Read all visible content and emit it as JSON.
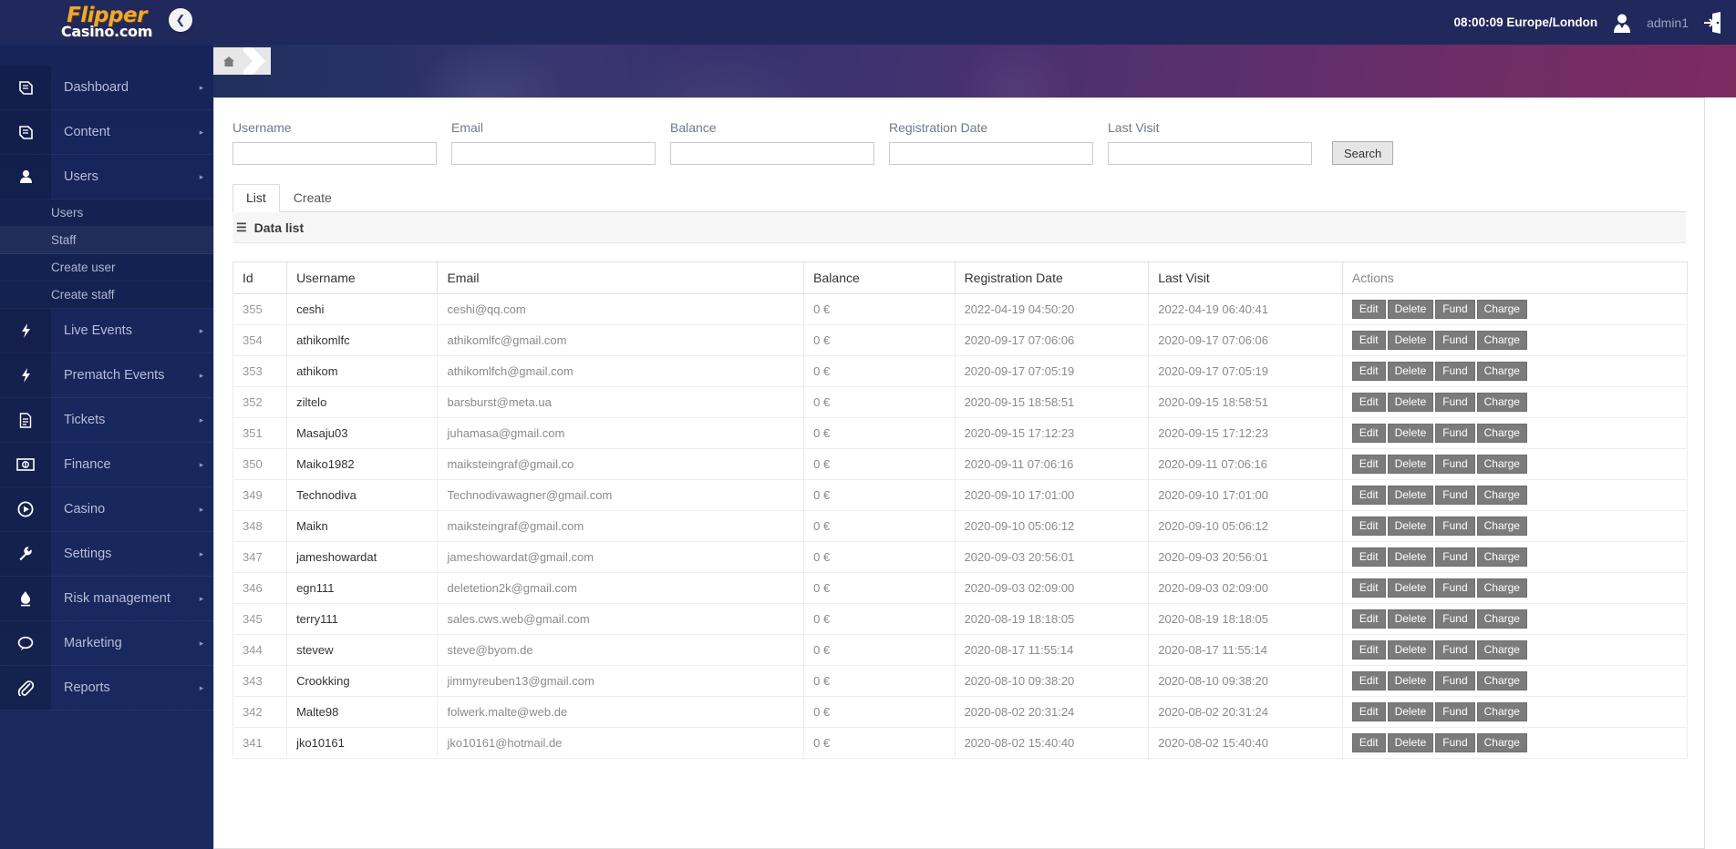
{
  "brand": {
    "name_top": "Flipper",
    "name_bottom": "Casino.com",
    "accent": "#f0a830",
    "sidebar_bg": "#17265a",
    "topbar_bg": "#21285c"
  },
  "topbar": {
    "clock": "08:00:09 Europe/London",
    "username": "admin1",
    "avatar_icon": "user-avatar-icon",
    "logout_icon": "logout-icon"
  },
  "sidebar": {
    "collapse_icon": "chevron-left-icon",
    "items": [
      {
        "label": "Dashboard",
        "icon": "book-icon",
        "arrow": "▸"
      },
      {
        "label": "Content",
        "icon": "book-icon",
        "arrow": "▸"
      },
      {
        "label": "Users",
        "icon": "user-icon",
        "arrow": "▸"
      },
      {
        "label": "Live Events",
        "icon": "bolt-icon",
        "arrow": "▸"
      },
      {
        "label": "Prematch Events",
        "icon": "bolt-icon",
        "arrow": "▸"
      },
      {
        "label": "Tickets",
        "icon": "document-icon",
        "arrow": "▸"
      },
      {
        "label": "Finance",
        "icon": "money-icon",
        "arrow": "▸"
      },
      {
        "label": "Casino",
        "icon": "play-circle-icon",
        "arrow": "▸"
      },
      {
        "label": "Settings",
        "icon": "wrench-icon",
        "arrow": "▸"
      },
      {
        "label": "Risk management",
        "icon": "flame-icon",
        "arrow": "▸"
      },
      {
        "label": "Marketing",
        "icon": "chat-icon",
        "arrow": "▸"
      },
      {
        "label": "Reports",
        "icon": "paperclip-icon",
        "arrow": "▸"
      }
    ],
    "users_submenu": [
      {
        "label": "Users",
        "active": false
      },
      {
        "label": "Staff",
        "active": true
      },
      {
        "label": "Create user",
        "active": false
      },
      {
        "label": "Create staff",
        "active": false
      }
    ]
  },
  "breadcrumb": {
    "home_icon": "home-icon",
    "chevron_icon": "chevron-right-icon"
  },
  "filters": {
    "fields": [
      {
        "label": "Username",
        "value": "",
        "placeholder": ""
      },
      {
        "label": "Email",
        "value": "",
        "placeholder": ""
      },
      {
        "label": "Balance",
        "value": "",
        "placeholder": ""
      },
      {
        "label": "Registration Date",
        "value": "",
        "placeholder": ""
      },
      {
        "label": "Last Visit",
        "value": "",
        "placeholder": ""
      }
    ],
    "search_label": "Search"
  },
  "tabs": [
    {
      "label": "List",
      "active": true
    },
    {
      "label": "Create",
      "active": false
    }
  ],
  "panel": {
    "icon": "hamburger-icon",
    "title": "Data list"
  },
  "table": {
    "columns": [
      "Id",
      "Username",
      "Email",
      "Balance",
      "Registration Date",
      "Last Visit",
      "Actions"
    ],
    "action_labels": [
      "Edit",
      "Delete",
      "Fund",
      "Charge"
    ],
    "rows": [
      {
        "id": "355",
        "username": "ceshi",
        "email": "ceshi@qq.com",
        "balance": "0 €",
        "registration": "2022-04-19 04:50:20",
        "last_visit": "2022-04-19 06:40:41"
      },
      {
        "id": "354",
        "username": "athikomlfc",
        "email": "athikomlfc@gmail.com",
        "balance": "0 €",
        "registration": "2020-09-17 07:06:06",
        "last_visit": "2020-09-17 07:06:06"
      },
      {
        "id": "353",
        "username": "athikom",
        "email": "athikomlfch@gmail.com",
        "balance": "0 €",
        "registration": "2020-09-17 07:05:19",
        "last_visit": "2020-09-17 07:05:19"
      },
      {
        "id": "352",
        "username": "ziltelo",
        "email": "barsburst@meta.ua",
        "balance": "0 €",
        "registration": "2020-09-15 18:58:51",
        "last_visit": "2020-09-15 18:58:51"
      },
      {
        "id": "351",
        "username": "Masaju03",
        "email": "juhamasa@gmail.com",
        "balance": "0 €",
        "registration": "2020-09-15 17:12:23",
        "last_visit": "2020-09-15 17:12:23"
      },
      {
        "id": "350",
        "username": "Maiko1982",
        "email": "maiksteingraf@gmail.co",
        "balance": "0 €",
        "registration": "2020-09-11 07:06:16",
        "last_visit": "2020-09-11 07:06:16"
      },
      {
        "id": "349",
        "username": "Technodiva",
        "email": "Technodivawagner@gmail.com",
        "balance": "0 €",
        "registration": "2020-09-10 17:01:00",
        "last_visit": "2020-09-10 17:01:00"
      },
      {
        "id": "348",
        "username": "Maikn",
        "email": "maiksteingraf@gmail.com",
        "balance": "0 €",
        "registration": "2020-09-10 05:06:12",
        "last_visit": "2020-09-10 05:06:12"
      },
      {
        "id": "347",
        "username": "jameshowardat",
        "email": "jameshowardat@gmail.com",
        "balance": "0 €",
        "registration": "2020-09-03 20:56:01",
        "last_visit": "2020-09-03 20:56:01"
      },
      {
        "id": "346",
        "username": "egn111",
        "email": "deletetion2k@gmail.com",
        "balance": "0 €",
        "registration": "2020-09-03 02:09:00",
        "last_visit": "2020-09-03 02:09:00"
      },
      {
        "id": "345",
        "username": "terry111",
        "email": "sales.cws.web@gmail.com",
        "balance": "0 €",
        "registration": "2020-08-19 18:18:05",
        "last_visit": "2020-08-19 18:18:05"
      },
      {
        "id": "344",
        "username": "stevew",
        "email": "steve@byom.de",
        "balance": "0 €",
        "registration": "2020-08-17 11:55:14",
        "last_visit": "2020-08-17 11:55:14"
      },
      {
        "id": "343",
        "username": "Crookking",
        "email": "jimmyreuben13@gmail.com",
        "balance": "0 €",
        "registration": "2020-08-10 09:38:20",
        "last_visit": "2020-08-10 09:38:20"
      },
      {
        "id": "342",
        "username": "Malte98",
        "email": "folwerk.malte@web.de",
        "balance": "0 €",
        "registration": "2020-08-02 20:31:24",
        "last_visit": "2020-08-02 20:31:24"
      },
      {
        "id": "341",
        "username": "jko10161",
        "email": "jko10161@hotmail.de",
        "balance": "0 €",
        "registration": "2020-08-02 15:40:40",
        "last_visit": "2020-08-02 15:40:40"
      }
    ]
  }
}
